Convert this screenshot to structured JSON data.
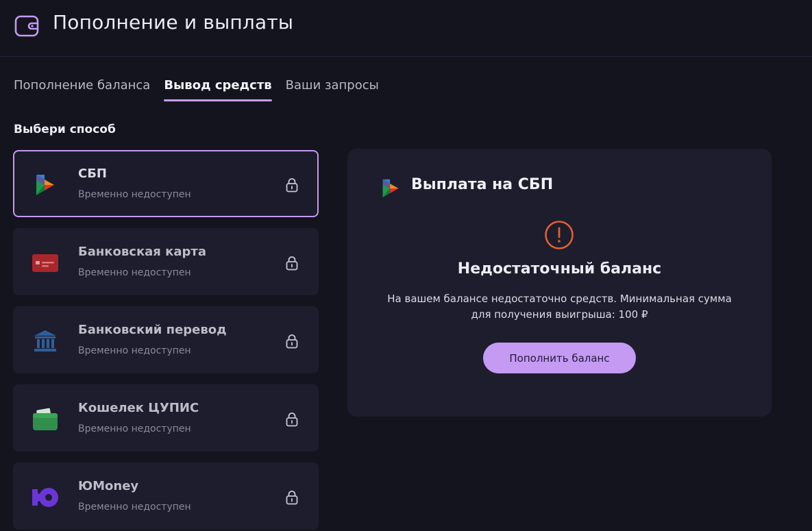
{
  "header": {
    "title": "Пополнение и выплаты",
    "icon": "wallet-icon"
  },
  "tabs": [
    {
      "label": "Пополнение баланса",
      "active": false
    },
    {
      "label": "Вывод средств",
      "active": true
    },
    {
      "label": "Ваши запросы",
      "active": false
    }
  ],
  "section_label": "Выбери способ",
  "methods": [
    {
      "name": "СБП",
      "status": "Временно недоступен",
      "icon": "sbp-logo-icon",
      "selected": true
    },
    {
      "name": "Банковская карта",
      "status": "Временно недоступен",
      "icon": "bank-card-icon",
      "selected": false
    },
    {
      "name": "Банковский перевод",
      "status": "Временно недоступен",
      "icon": "bank-building-icon",
      "selected": false
    },
    {
      "name": "Кошелек ЦУПИС",
      "status": "Временно недоступен",
      "icon": "cupis-wallet-icon",
      "selected": false
    },
    {
      "name": "ЮMoney",
      "status": "Временно недоступен",
      "icon": "yoomoney-icon",
      "selected": false
    }
  ],
  "panel": {
    "title": "Выплата на СБП",
    "warning_title": "Недостаточный баланс",
    "warning_text_line1": "На вашем балансе недостаточно средств. Минимальная сумма",
    "warning_text_line2": "для получения выигрыша: 100 ₽",
    "button_label": "Пополнить баланс"
  },
  "colors": {
    "background": "#14141f",
    "card": "#1d1d2d",
    "accent": "#c49af3",
    "warning": "#e0612f"
  }
}
